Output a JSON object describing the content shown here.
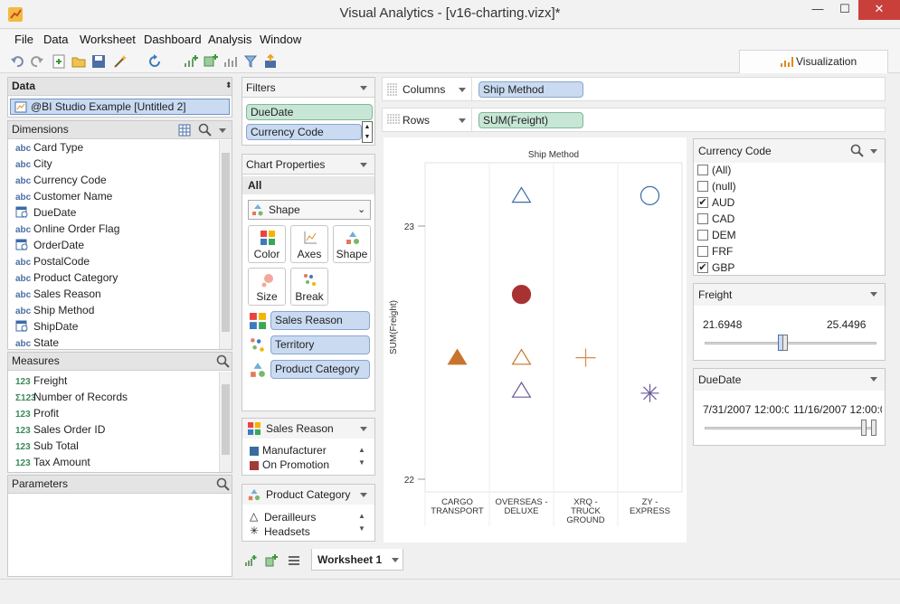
{
  "window": {
    "title": "Visual Analytics - [v16-charting.vizx]*",
    "minimize": "—",
    "maximize": "☐",
    "close": "✕"
  },
  "menu": [
    "File",
    "Data",
    "Worksheet",
    "Dashboard",
    "Analysis",
    "Window"
  ],
  "toolbar_icons": [
    "undo-icon",
    "redo-icon",
    "new-icon",
    "open-icon",
    "save-icon",
    "wand-icon",
    "refresh-icon",
    "add-chart-icon",
    "add-grid-icon",
    "bar-chart-icon",
    "filter-icon",
    "export-icon"
  ],
  "vis_tab": {
    "label": "Visualization"
  },
  "data_panel": {
    "title": "Data",
    "source": "@BI Studio Example [Untitled 2]"
  },
  "dimensions": {
    "title": "Dimensions",
    "items": [
      {
        "type": "abc",
        "label": "Card Type"
      },
      {
        "type": "abc",
        "label": "City"
      },
      {
        "type": "abc",
        "label": "Currency Code"
      },
      {
        "type": "abc",
        "label": "Customer Name"
      },
      {
        "type": "date",
        "label": "DueDate"
      },
      {
        "type": "abc",
        "label": "Online Order Flag"
      },
      {
        "type": "date",
        "label": "OrderDate"
      },
      {
        "type": "abc",
        "label": "PostalCode"
      },
      {
        "type": "abc",
        "label": "Product Category"
      },
      {
        "type": "abc",
        "label": "Sales Reason"
      },
      {
        "type": "abc",
        "label": "Ship Method"
      },
      {
        "type": "date",
        "label": "ShipDate"
      },
      {
        "type": "abc",
        "label": "State"
      }
    ]
  },
  "measures": {
    "title": "Measures",
    "items": [
      {
        "type": "123",
        "label": "Freight"
      },
      {
        "type": "Σ123",
        "label": "Number of Records"
      },
      {
        "type": "123",
        "label": "Profit"
      },
      {
        "type": "123",
        "label": "Sales Order ID"
      },
      {
        "type": "123",
        "label": "Sub Total"
      },
      {
        "type": "123",
        "label": "Tax Amount"
      }
    ]
  },
  "parameters": {
    "title": "Parameters"
  },
  "filters": {
    "title": "Filters",
    "items": [
      "DueDate",
      "Currency Code"
    ]
  },
  "chart_properties": {
    "title": "Chart Properties",
    "all": "All",
    "mark": "Shape",
    "buttons": [
      "Color",
      "Axes",
      "Shape",
      "Size",
      "Break"
    ],
    "encodings": [
      "Sales Reason",
      "Territory",
      "Product Category"
    ]
  },
  "legend_sales_reason": {
    "title": "Sales Reason",
    "items": [
      {
        "label": "Manufacturer",
        "color": "#3b6aa0"
      },
      {
        "label": "On Promotion",
        "color": "#a33a3a"
      }
    ]
  },
  "legend_product_category": {
    "title": "Product Category",
    "items": [
      {
        "label": "Derailleurs",
        "symbol": "△"
      },
      {
        "label": "Headsets",
        "symbol": "✳"
      }
    ]
  },
  "shelves": {
    "columns_label": "Columns",
    "columns_pill": "Ship Method",
    "rows_label": "Rows",
    "rows_pill": "SUM(Freight)"
  },
  "chart_data": {
    "type": "scatter",
    "title": "Ship Method",
    "ylabel": "SUM(Freight)",
    "categories": [
      "CARGO\nTRANSPORT",
      "OVERSEAS -\nDELUXE",
      "XRQ -\nTRUCK\nGROUND",
      "ZY -\nEXPRESS"
    ],
    "yticks": [
      22,
      23
    ],
    "ylim": [
      21.95,
      23.25
    ],
    "points": [
      {
        "cat": 0,
        "y": 22.48,
        "shape": "triangle-filled",
        "color": "#c8742c"
      },
      {
        "cat": 1,
        "y": 23.12,
        "shape": "triangle",
        "color": "#3c6aa8"
      },
      {
        "cat": 1,
        "y": 22.73,
        "shape": "circle-filled",
        "color": "#a83232"
      },
      {
        "cat": 1,
        "y": 22.48,
        "shape": "triangle",
        "color": "#c8742c"
      },
      {
        "cat": 1,
        "y": 22.35,
        "shape": "triangle",
        "color": "#6a5a9c"
      },
      {
        "cat": 2,
        "y": 22.48,
        "shape": "plus",
        "color": "#d8884a"
      },
      {
        "cat": 3,
        "y": 23.12,
        "shape": "circle",
        "color": "#3c6aa8"
      },
      {
        "cat": 3,
        "y": 22.34,
        "shape": "asterisk",
        "color": "#6a5a9c"
      }
    ]
  },
  "currency_filter": {
    "title": "Currency Code",
    "items": [
      {
        "label": "(All)",
        "checked": false
      },
      {
        "label": "(null)",
        "checked": false
      },
      {
        "label": "AUD",
        "checked": true
      },
      {
        "label": "CAD",
        "checked": false
      },
      {
        "label": "DEM",
        "checked": false
      },
      {
        "label": "FRF",
        "checked": false
      },
      {
        "label": "GBP",
        "checked": true
      }
    ]
  },
  "freight_filter": {
    "title": "Freight",
    "min": "21.6948",
    "max": "25.4496",
    "range_fraction": [
      0.44,
      0.46
    ]
  },
  "duedate_filter": {
    "title": "DueDate",
    "min": "7/31/2007 12:00:0(",
    "max": "11/16/2007 12:00:0",
    "range_fraction": [
      0.95,
      1.0
    ]
  },
  "sheet_tabs": {
    "active": "Worksheet 1"
  }
}
